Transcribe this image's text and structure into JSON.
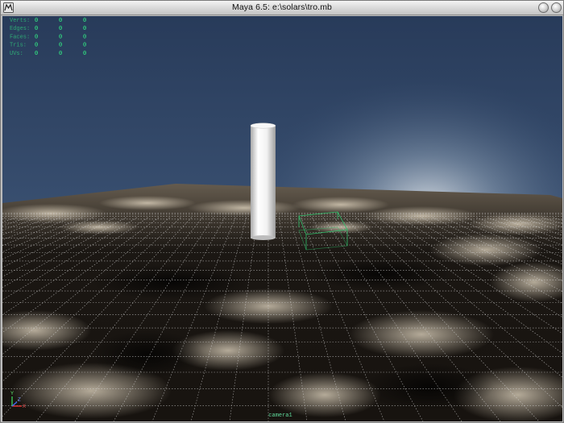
{
  "window": {
    "title": "Maya 6.5: e:\\solars\\tro.mb",
    "icons": {
      "app": "maya-app-icon",
      "minimize": "minimize-icon",
      "close": "close-icon"
    }
  },
  "viewport": {
    "camera_label": "camera1",
    "hud_rows": [
      {
        "label": "Verts:",
        "values": [
          "0",
          "0",
          "0"
        ]
      },
      {
        "label": "Edges:",
        "values": [
          "0",
          "0",
          "0"
        ]
      },
      {
        "label": "Faces:",
        "values": [
          "0",
          "0",
          "0"
        ]
      },
      {
        "label": "Tris:",
        "values": [
          "0",
          "0",
          "0"
        ]
      },
      {
        "label": "UVs:",
        "values": [
          "0",
          "0",
          "0"
        ]
      }
    ],
    "axis": {
      "x": "X",
      "y": "Y",
      "z": "Z"
    },
    "colors": {
      "sky_top": "#2c4161",
      "sky_glow": "#a7b6c6",
      "hud": "#33ff88",
      "grid": "#d8d8d8",
      "selection_box": "#2fbf6a"
    }
  }
}
